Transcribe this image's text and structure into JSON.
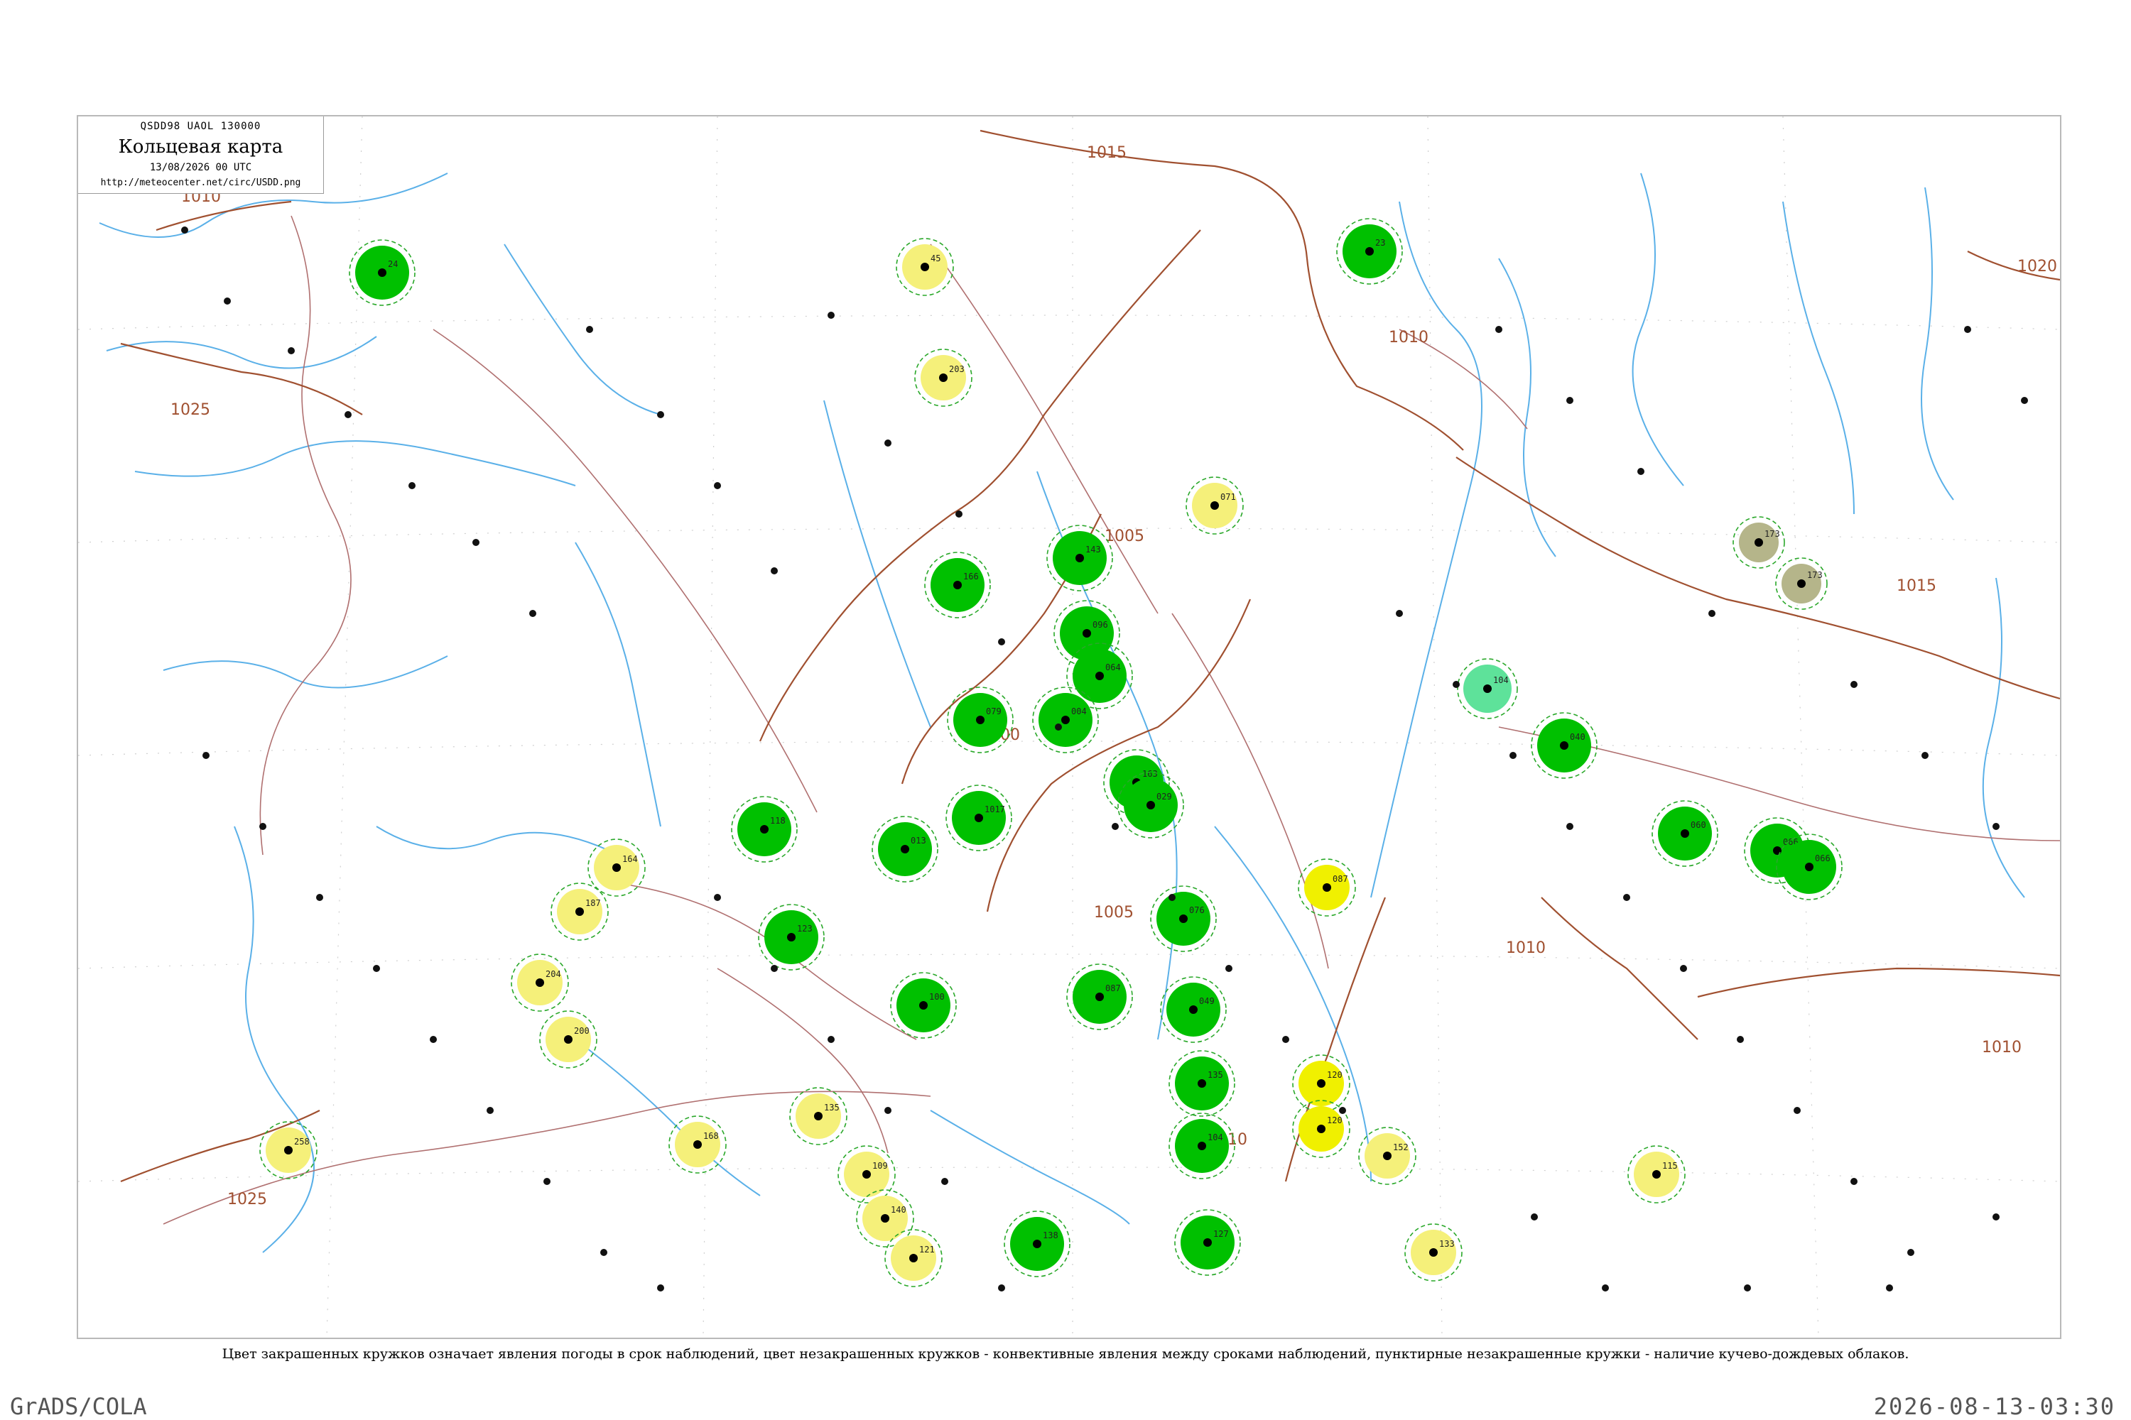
{
  "header": {
    "code": "QSDD98  UAOL  130000",
    "title": "Кольцевая карта",
    "date": "13/08/2026 00 UTC",
    "url": "http://meteocenter.net/circ/USDD.png"
  },
  "legend": "Цвет закрашенных кружков означает явления погоды в срок наблюдений, цвет незакрашенных кружков - конвективные явления между сроками наблюдений, пунктирные незакрашенные кружки - наличие кучево-дождевых облаков.",
  "footer": {
    "left": "GrADS/COLA",
    "right": "2026-08-13-03:30"
  },
  "isobars": [
    {
      "label": "1015"
    },
    {
      "label": "1010"
    },
    {
      "label": "1005"
    },
    {
      "label": "1000"
    },
    {
      "label": "1005"
    },
    {
      "label": "1010"
    },
    {
      "label": "1025"
    },
    {
      "label": "1025"
    },
    {
      "label": "1020"
    },
    {
      "label": "1015"
    },
    {
      "label": "1010"
    },
    {
      "label": "1010"
    },
    {
      "label": "1010"
    }
  ],
  "colors": {
    "rain": "#00c000",
    "shower": "#2dbd2d",
    "drizzle": "#f5f07a",
    "fog": "#f0f000",
    "haze": "#b5b58a",
    "rain-light": "#5ee29a",
    "convective-ring": "#2aa82a",
    "thunder-ring": "#d03050",
    "isobar": "#a05030",
    "river": "#5ab0e8",
    "road": "#b07070"
  },
  "stations": [
    {
      "kind": "rain",
      "label": "24"
    },
    {
      "kind": "rain",
      "label": "23"
    },
    {
      "kind": "drizzle",
      "label": "45"
    },
    {
      "kind": "drizzle",
      "label": "203"
    },
    {
      "kind": "drizzle",
      "label": "071"
    },
    {
      "kind": "rain",
      "label": "166"
    },
    {
      "kind": "rain",
      "label": "143"
    },
    {
      "kind": "rain",
      "label": "096"
    },
    {
      "kind": "rain",
      "label": "064"
    },
    {
      "kind": "rain",
      "label": "004"
    },
    {
      "kind": "rain",
      "label": "079"
    },
    {
      "kind": "rain",
      "label": "1017"
    },
    {
      "kind": "rain",
      "label": "013"
    },
    {
      "kind": "rain",
      "label": "118"
    },
    {
      "kind": "rain",
      "label": "123"
    },
    {
      "kind": "rain",
      "label": "100"
    },
    {
      "kind": "rain",
      "label": "163"
    },
    {
      "kind": "rain",
      "label": "029"
    },
    {
      "kind": "rain",
      "label": "087"
    },
    {
      "kind": "rain",
      "label": "076"
    },
    {
      "kind": "rain",
      "label": "049"
    },
    {
      "kind": "rain",
      "label": "135"
    },
    {
      "kind": "rain",
      "label": "104"
    },
    {
      "kind": "rain",
      "label": "127"
    },
    {
      "kind": "rain",
      "label": "138"
    },
    {
      "kind": "fog",
      "label": "087"
    },
    {
      "kind": "fog",
      "label": "120"
    },
    {
      "kind": "fog",
      "label": "120"
    },
    {
      "kind": "drizzle",
      "label": "164"
    },
    {
      "kind": "drizzle",
      "label": "187"
    },
    {
      "kind": "drizzle",
      "label": "204"
    },
    {
      "kind": "drizzle",
      "label": "200"
    },
    {
      "kind": "drizzle",
      "label": "168"
    },
    {
      "kind": "drizzle",
      "label": "258"
    },
    {
      "kind": "drizzle",
      "label": "135"
    },
    {
      "kind": "drizzle",
      "label": "109"
    },
    {
      "kind": "drizzle",
      "label": "140"
    },
    {
      "kind": "drizzle",
      "label": "121"
    },
    {
      "kind": "drizzle",
      "label": "152"
    },
    {
      "kind": "drizzle",
      "label": "133"
    },
    {
      "kind": "drizzle",
      "label": "115"
    },
    {
      "kind": "haze",
      "label": "173"
    },
    {
      "kind": "haze",
      "label": "173"
    },
    {
      "kind": "rain-light",
      "label": "104"
    },
    {
      "kind": "rain",
      "label": "040"
    },
    {
      "kind": "rain",
      "label": "060"
    },
    {
      "kind": "rain",
      "label": "066"
    },
    {
      "kind": "rain",
      "label": "066"
    }
  ]
}
